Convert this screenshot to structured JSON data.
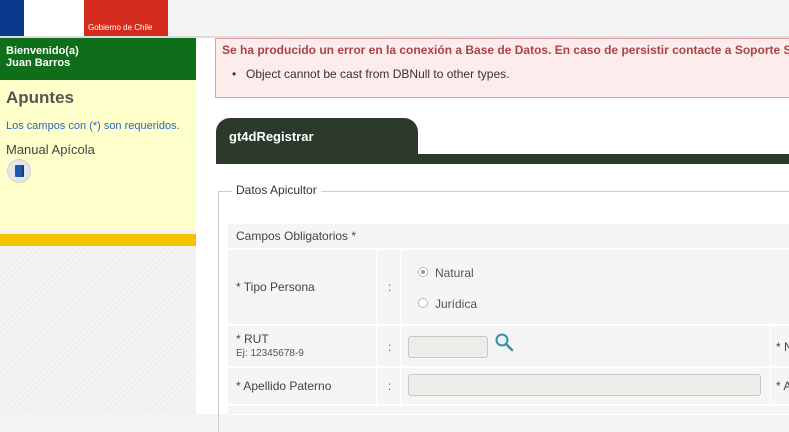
{
  "header": {
    "logo_text": "Gobierno de Chile"
  },
  "sidebar": {
    "welcome_line1": "Bienvenido(a)",
    "welcome_line2": "Juan Barros",
    "title": "Apuntes",
    "required_note": "Los campos con (*) son requeridos.",
    "manual_label": "Manual Apícola",
    "manual_icon": "book-icon"
  },
  "error": {
    "title": "Se ha producido un error en la conexión a Base de Datos. En caso de persistir contacte a Soporte Si",
    "items": [
      "Object cannot be cast from DBNull to other types."
    ]
  },
  "tab": {
    "label": "gt4dRegistrar"
  },
  "form": {
    "legend": "Datos Apicultor",
    "section_header": "Campos Obligatorios *",
    "tipo_persona": {
      "label": "* Tipo Persona",
      "colon": ":",
      "options": [
        "Natural",
        "Jurídica"
      ],
      "selected": "Natural"
    },
    "rut": {
      "label": "* RUT",
      "example": "Ej: 12345678-9",
      "colon": ":",
      "value": "",
      "right_edge_label": "* N"
    },
    "apellido_paterno": {
      "label": "* Apellido Paterno",
      "colon": ":",
      "value": "",
      "right_edge_label": "* A"
    }
  },
  "colors": {
    "welcome_bg": "#0f6e1a",
    "sidebar_panel_bg": "#ffffcc",
    "sidebar_yellow_bar": "#f5c400",
    "tab_bg": "#2c3a2c",
    "error_bg": "#fdecec",
    "error_text": "#a94442"
  }
}
